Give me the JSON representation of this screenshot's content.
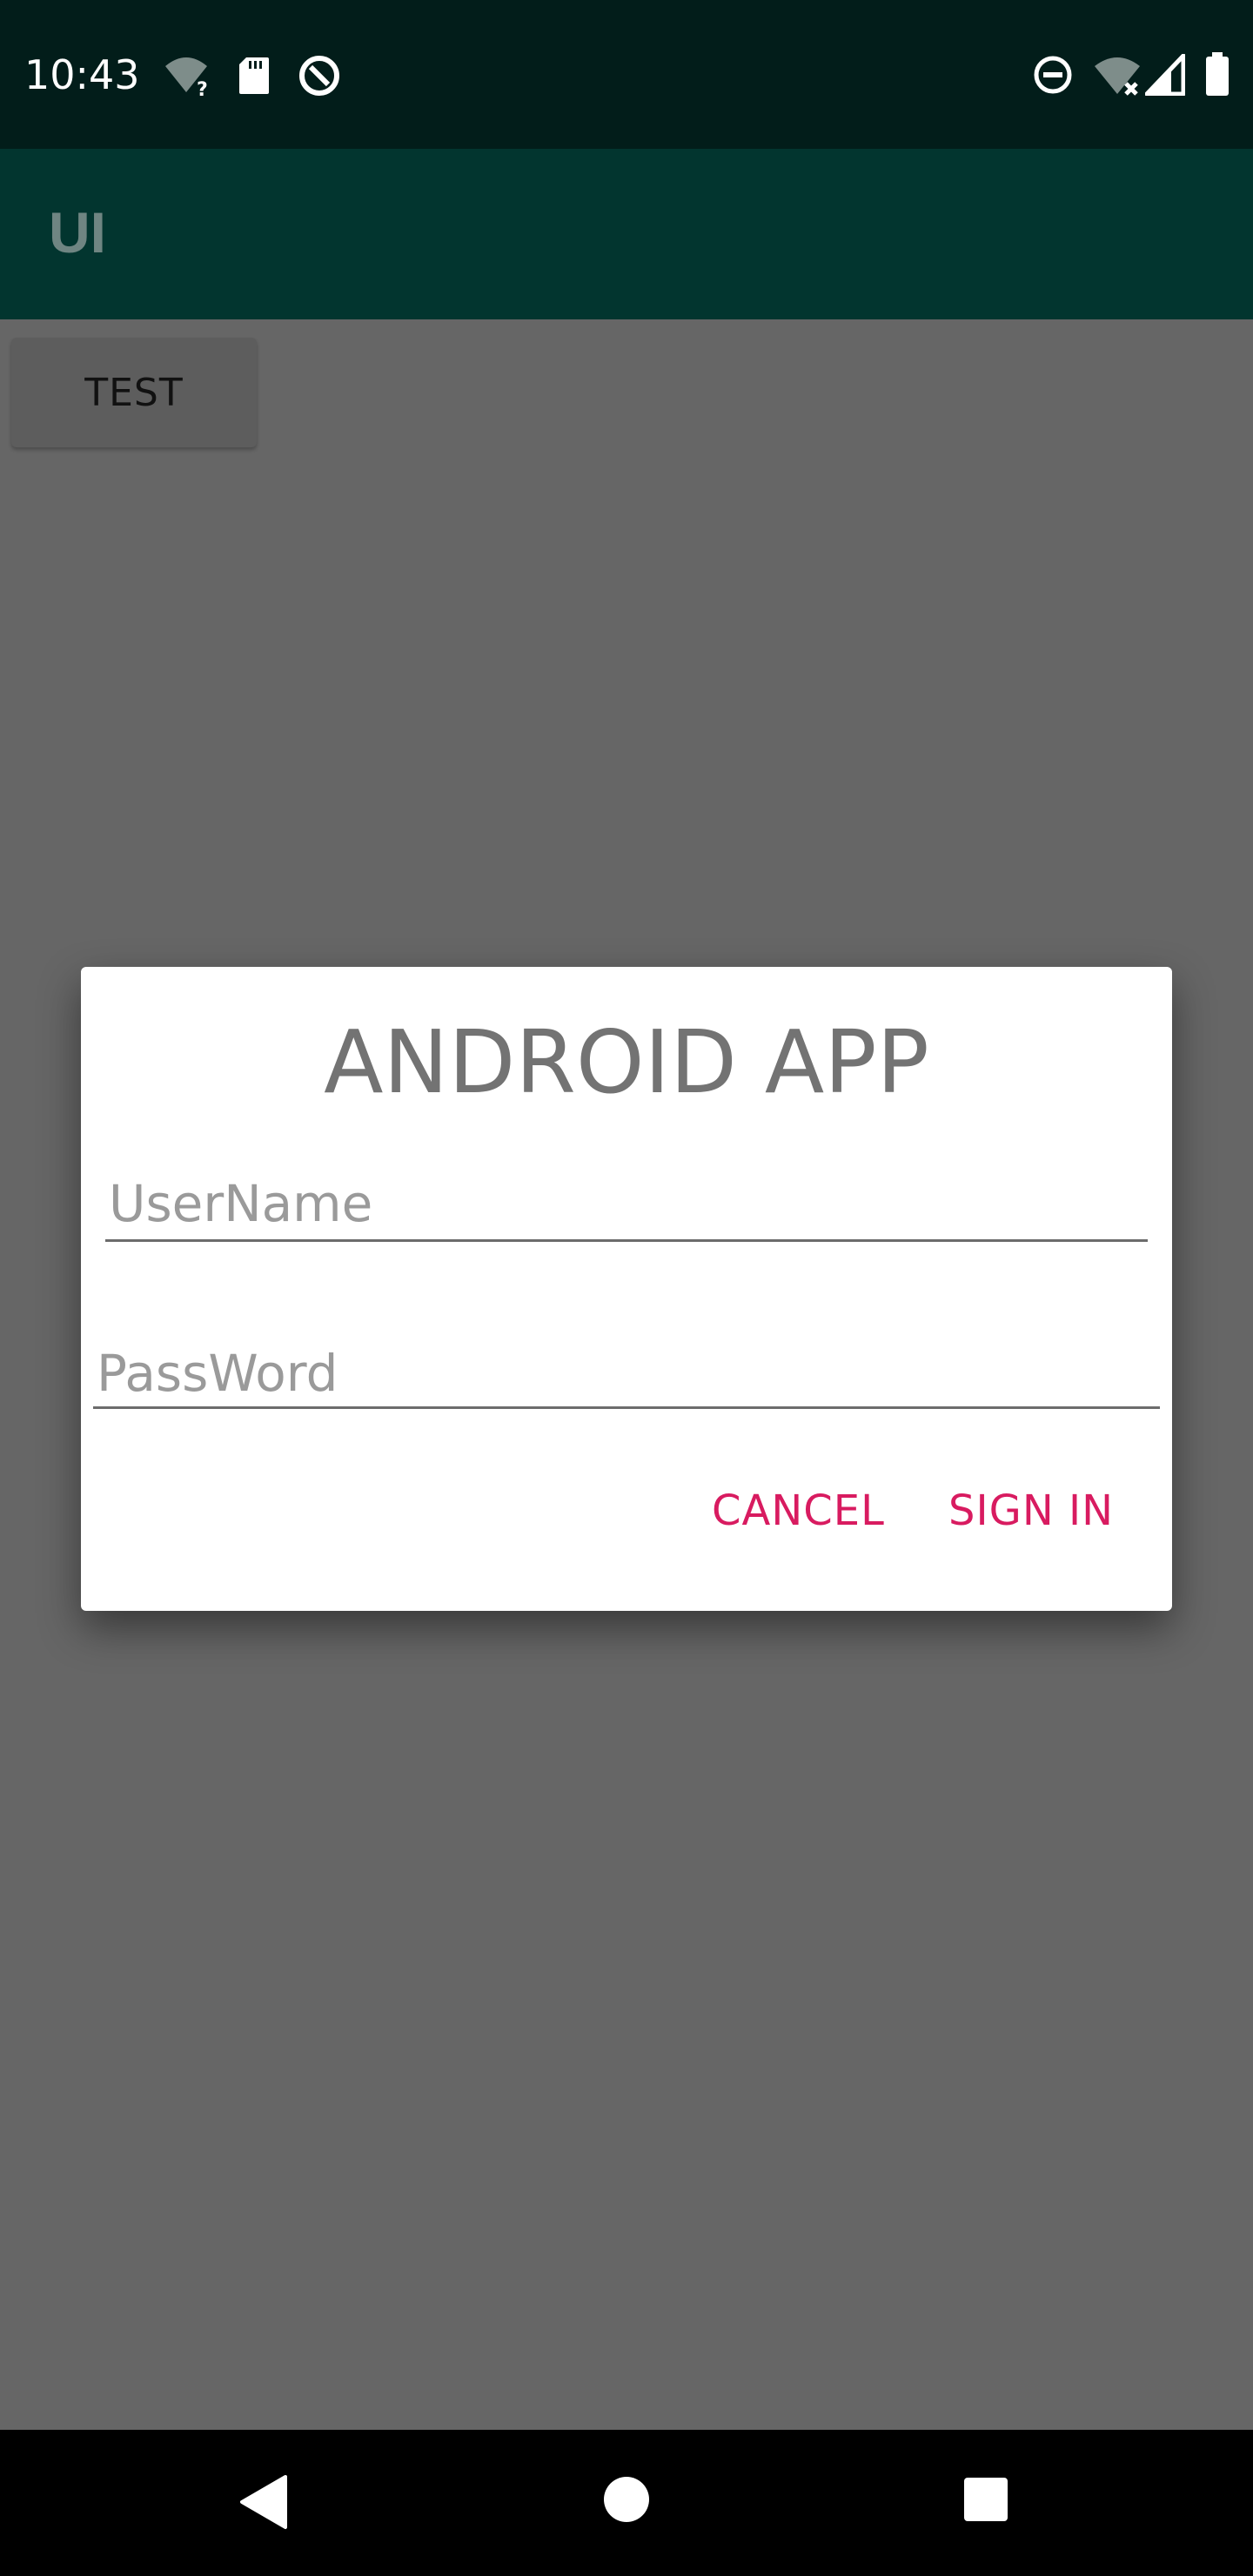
{
  "status_bar": {
    "time": "10:43",
    "icons_left": [
      "wifi-question-icon",
      "sd-card-icon",
      "data-saver-icon"
    ],
    "icons_right": [
      "do-not-disturb-icon",
      "wifi-off-icon",
      "signal-icon",
      "battery-icon"
    ]
  },
  "app_bar": {
    "title": "UI"
  },
  "main": {
    "test_button_label": "TEST"
  },
  "dialog": {
    "title": "ANDROID APP",
    "username": {
      "placeholder": "UserName",
      "value": ""
    },
    "password": {
      "placeholder": "PassWord",
      "value": ""
    },
    "cancel_label": "CANCEL",
    "sign_in_label": "SIGN IN"
  },
  "nav_bar": {
    "buttons": [
      "back-icon",
      "home-icon",
      "recents-icon"
    ]
  },
  "colors": {
    "status_bar": "#021d1a",
    "app_bar": "#02352f",
    "scrim": "#666666",
    "accent": "#d81b60"
  }
}
